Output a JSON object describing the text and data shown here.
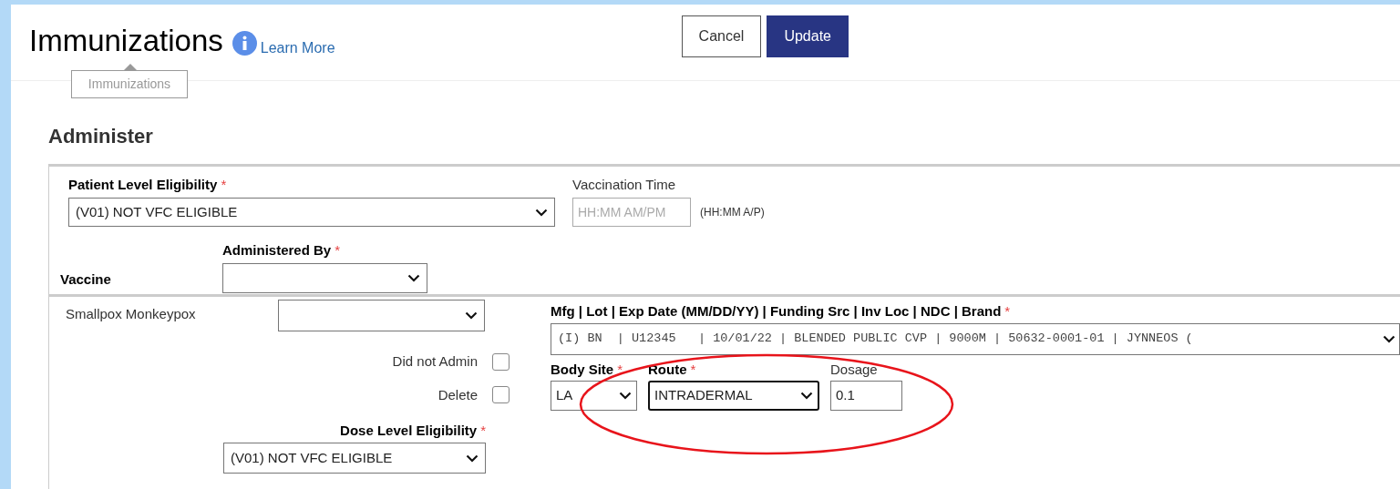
{
  "header": {
    "title": "Immunizations",
    "info_link": "Learn More",
    "tooltip": "Immunizations",
    "buttons": [
      {
        "label": "Cancel",
        "kind": "secondary"
      },
      {
        "label": "Update",
        "kind": "primary"
      }
    ]
  },
  "section_title": "Administer",
  "patient_eligibility": {
    "label": "Patient Level Eligibility",
    "required_mark": "*",
    "value": "(V01) NOT VFC ELIGIBLE"
  },
  "vaccination_time": {
    "label": "Vaccination Time",
    "placeholder": "HH:MM AM/PM",
    "hint": "(HH:MM A/P)"
  },
  "vaccine_label": "Vaccine",
  "administered_by": {
    "label": "Administered By",
    "required_mark": "*"
  },
  "vaccine_row": {
    "name": "Smallpox Monkeypox",
    "lot": {
      "label": "Mfg | Lot | Exp Date (MM/DD/YY) | Funding Src | Inv Loc | NDC | Brand",
      "required_mark": "*",
      "value": "(I) BN  | U12345   | 10/01/22 | BLENDED PUBLIC CVP | 9000M | 50632-0001-01 | JYNNEOS ("
    },
    "checkboxes": [
      {
        "label": "Did not Admin",
        "checked": false
      },
      {
        "label": "Delete",
        "checked": false
      }
    ],
    "fields": [
      {
        "kind": "select",
        "label": "Body Site",
        "required_mark": "*",
        "value": "LA",
        "focused": false
      },
      {
        "kind": "select",
        "label": "Route",
        "required_mark": "*",
        "value": "INTRADERMAL",
        "focused": true
      },
      {
        "kind": "input",
        "label": "Dosage",
        "value": "0.1",
        "focused": false
      }
    ],
    "dose_eligibility": {
      "label": "Dose Level Eligibility",
      "required_mark": "*",
      "value": "(V01) NOT VFC ELIGIBLE"
    }
  }
}
